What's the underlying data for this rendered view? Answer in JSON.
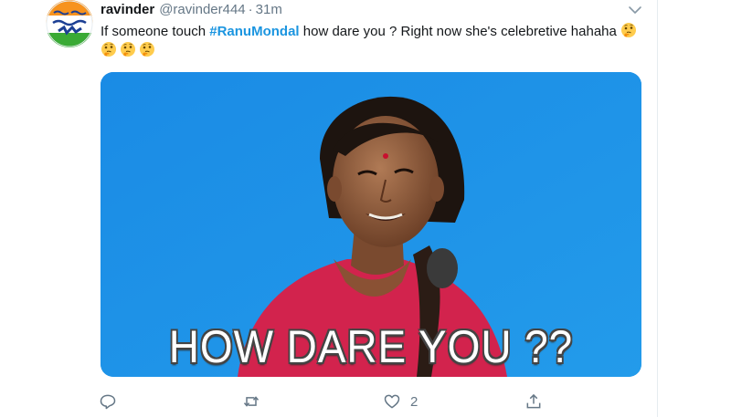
{
  "tweet": {
    "display_name": "ravinder",
    "handle": "@ravinder444",
    "separator": "·",
    "time": "31m",
    "text_before": "If someone touch ",
    "hashtag": "#RanuMondal",
    "text_after": " how dare you ? Right now she's celebretive hahaha",
    "emoji_icon": "thinking-face-icon",
    "emoji_count": 4,
    "media_caption": "HOW DARE YOU ??",
    "actions": {
      "reply_icon": "reply-icon",
      "retweet_icon": "retweet-icon",
      "like_icon": "heart-icon",
      "like_count": "2",
      "share_icon": "share-icon"
    }
  },
  "colors": {
    "hashtag": "#1b95e0",
    "secondary_text": "#657786",
    "media_background": "#1d8fe6"
  }
}
